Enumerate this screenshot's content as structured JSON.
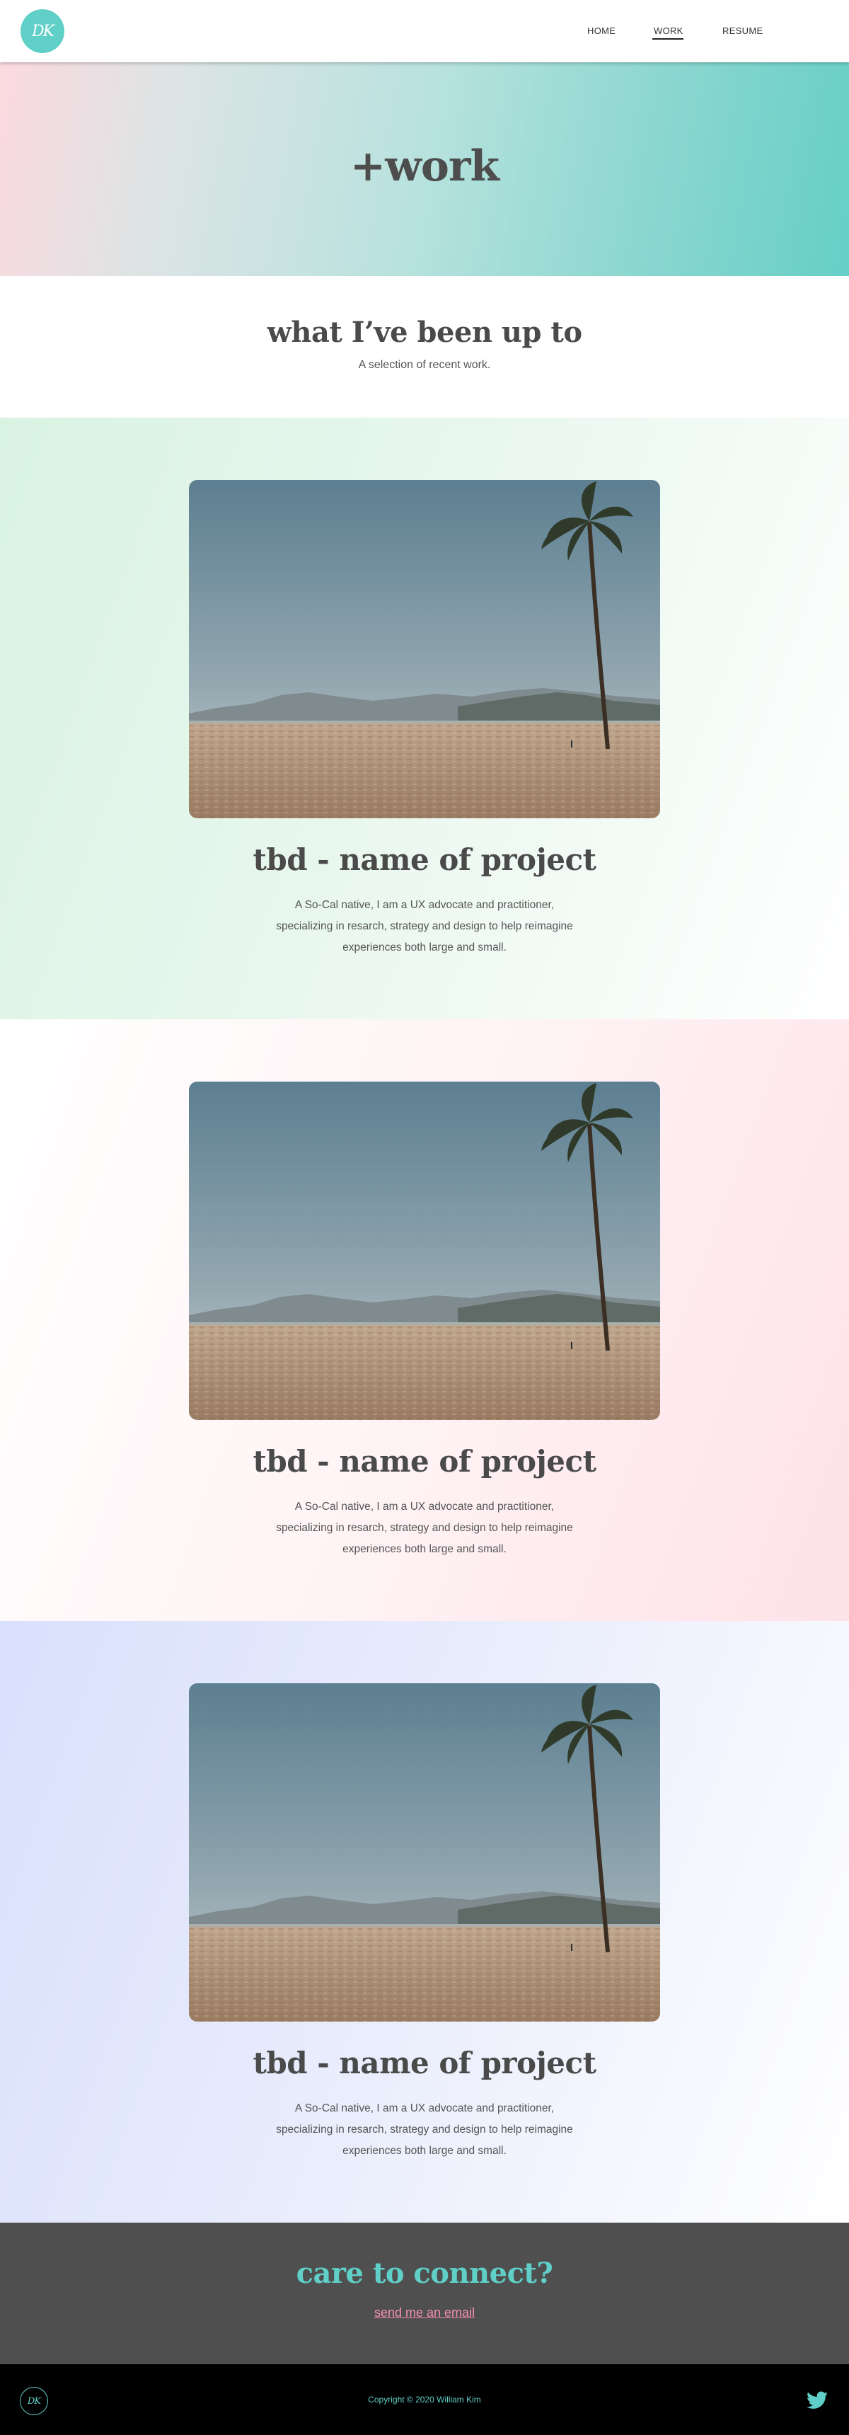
{
  "header": {
    "logo_text": "DK",
    "nav": {
      "home": "HOME",
      "work": "WORK",
      "resume": "RESUME"
    },
    "active_nav": "WORK"
  },
  "hero": {
    "title": "+work"
  },
  "intro": {
    "title": "what I’ve been up to",
    "subtitle": "A selection of recent work."
  },
  "projects": [
    {
      "title": "tbd - name of project",
      "description": "A So-Cal native, I am a UX advocate and practitioner, specializing in resarch, strategy and design to help reimagine experiences both large and small.",
      "image": "beach-with-palm-tree",
      "background": "mint-gradient"
    },
    {
      "title": "tbd - name of project",
      "description": "A So-Cal native, I am a UX advocate and practitioner, specializing in resarch, strategy and design to help reimagine experiences both large and small.",
      "image": "beach-with-palm-tree",
      "background": "pink-gradient"
    },
    {
      "title": "tbd - name of project",
      "description": "A So-Cal native, I am a UX advocate and practitioner, specializing in resarch, strategy and design to help reimagine experiences both large and small.",
      "image": "beach-with-palm-tree",
      "background": "lavender-gradient"
    }
  ],
  "contact": {
    "title": "care to connect?",
    "link": "send me an email"
  },
  "footer": {
    "logo_text": "DK",
    "copyright": "Copyright © 2020 William Kim",
    "social_icon": "twitter-icon"
  },
  "colors": {
    "accent_teal": "#5fcfc7",
    "link_pink": "#f48fb1",
    "heading": "#4a4a4a",
    "contact_bg": "#4f4f4f",
    "footer_bg": "#000000"
  }
}
